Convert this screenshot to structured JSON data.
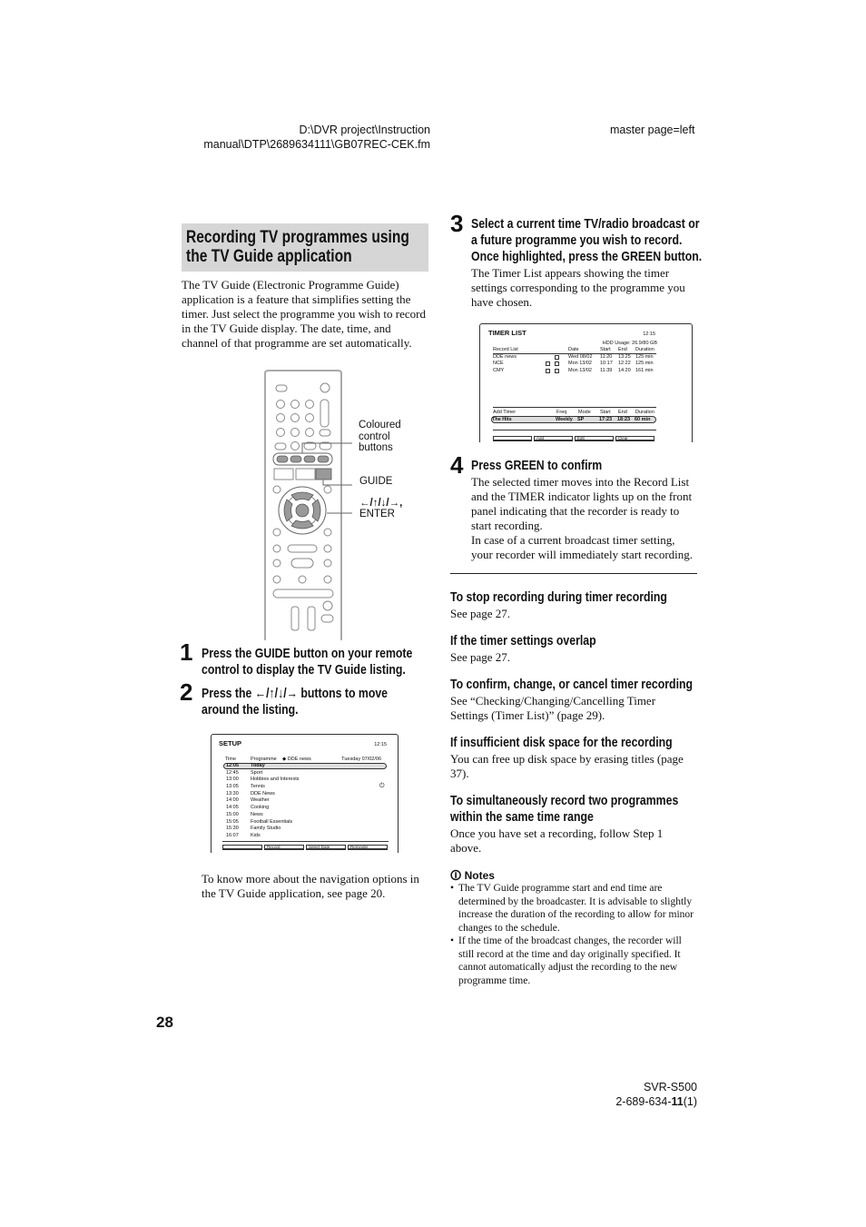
{
  "header": {
    "path_line1": "D:\\DVR project\\Instruction",
    "path_line2": "manual\\DTP\\2689634111\\GB07REC-CEK.fm",
    "master": "master page=left"
  },
  "section_title_line1": "Recording TV programmes using",
  "section_title_line2": "the TV Guide application",
  "intro": "The TV Guide (Electronic Programme Guide) application is a feature that simplifies setting the timer. Just select the programme you wish to record in the TV Guide display. The date, time, and channel of that programme are set automatically.",
  "remote": {
    "label_coloured": [
      "Coloured",
      "control",
      "buttons"
    ],
    "label_guide": "GUIDE",
    "label_arrows": "←/↑/↓/→,",
    "label_enter": "ENTER"
  },
  "steps": [
    {
      "num": "1",
      "lines": [
        "Press the GUIDE button on your remote",
        "control to display the TV Guide listing."
      ]
    },
    {
      "num": "2",
      "lines": [
        "Press the ←/↑/↓/→ buttons to move",
        "around the listing."
      ]
    },
    {
      "num": "3",
      "lines": [
        "Select a current time TV/radio broadcast or",
        "a future programme you wish to record.",
        "Once highlighted, press the GREEN button."
      ],
      "desc": "The Timer List appears showing the timer settings corresponding to the programme you have chosen."
    },
    {
      "num": "4",
      "lines": [
        "Press GREEN to confirm"
      ],
      "desc": "The selected timer moves into the Record List and the TIMER indicator lights up on the front panel indicating that the recorder is ready to start recording.",
      "desc2": "In case of a current broadcast timer setting, your recorder will immediately start recording."
    }
  ],
  "setup_screen": {
    "title": "SETUP",
    "clock": "12:15",
    "col_time": "Time",
    "col_programme": "Programme",
    "channel": "DDE news",
    "date": "Tuesday 07/02/06",
    "rows": [
      [
        "12:05",
        "Today"
      ],
      [
        "12:45",
        "Sport"
      ],
      [
        "13:00",
        "Hobbies and Interests"
      ],
      [
        "13:05",
        "Tennis"
      ],
      [
        "13:30",
        "DDE  News"
      ],
      [
        "14:00",
        "Weather"
      ],
      [
        "14:05",
        "Cooking"
      ],
      [
        "15:00",
        "News"
      ],
      [
        "15:05",
        "Football Essentials"
      ],
      [
        "15:30",
        "Family Studio"
      ],
      [
        "16:07",
        "Kids"
      ]
    ],
    "buttons": [
      "",
      "Record",
      "Select Date",
      "Reminder"
    ]
  },
  "caption": "To know more about the navigation options in the TV Guide application, see page 20.",
  "timer_screen": {
    "title": "TIMER LIST",
    "clock": "12:15",
    "hdd": "HDD Usage: 26.9/80 GB",
    "headers": [
      "Record List",
      "Date",
      "Start",
      "End",
      "Duration"
    ],
    "rows": [
      [
        "DDE news",
        "Wed 08/02",
        "11:20",
        "13:25",
        "125 min"
      ],
      [
        "NCE",
        "Mon 13/02",
        "10:17",
        "12:22",
        "125 min"
      ],
      [
        "CMY",
        "Mon 13/02",
        "11:39",
        "14:20",
        "161 min"
      ]
    ],
    "add_headers": [
      "Add Timer",
      "Freq",
      "Mode",
      "Start",
      "End",
      "Duration"
    ],
    "add_row": [
      "The Hits",
      "Weekly",
      "SP",
      "17:23",
      "18:23",
      "60 min"
    ],
    "buttons": [
      "",
      "Add",
      "Edit",
      "Clear"
    ]
  },
  "topics": [
    {
      "title": "To stop recording during timer recording",
      "text": "See page 27."
    },
    {
      "title": "If the timer settings overlap",
      "text": "See page 27."
    },
    {
      "title": "To confirm, change, or cancel timer recording",
      "text": "See “Checking/Changing/Cancelling Timer Settings (Timer List)” (page 29)."
    },
    {
      "title": "If insufficient disk space for the recording",
      "text": "You can free up disk space by erasing titles (page 37)."
    },
    {
      "title_lines": [
        "To simultaneously record two programmes",
        "within the same time range"
      ],
      "text": "Once you have set a recording, follow Step 1 above."
    }
  ],
  "notes": {
    "title": "Notes",
    "items": [
      "The TV Guide programme start and end time are determined by the broadcaster. It is advisable to slightly increase the duration of the recording to allow for minor changes to the schedule.",
      "If the time of the broadcast changes, the recorder will still record at the time and day originally specified. It cannot automatically adjust the recording to the new programme time."
    ]
  },
  "page_number": "28",
  "footer": {
    "model": "SVR-S500",
    "code_prefix": "2-689-634-",
    "code_bold": "11",
    "code_suffix": "(1)"
  }
}
